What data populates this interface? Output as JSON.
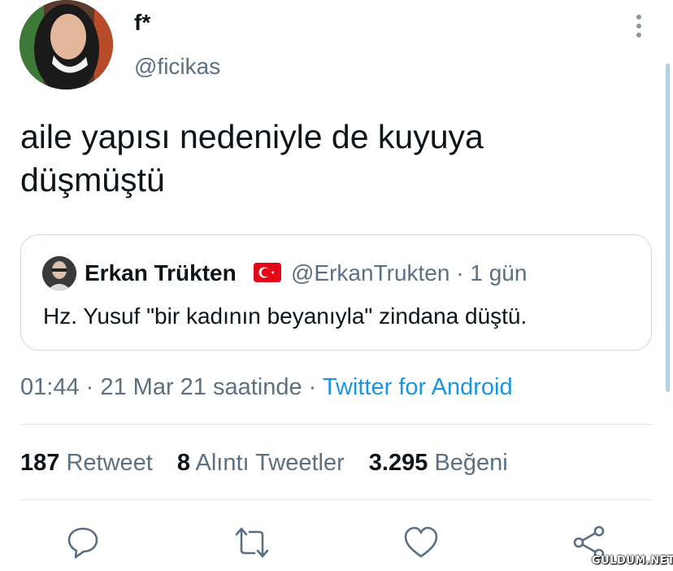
{
  "author": {
    "display_name": "f*",
    "handle": "@ficikas"
  },
  "tweet": {
    "text_line1": "aile yapısı nedeniyle de kuyuya",
    "text_line2": "düşmüştü"
  },
  "quoted_tweet": {
    "display_name": "Erkan Trükten",
    "handle_time": "@ErkanTrukten · 1 gün",
    "text": "Hz. Yusuf \"bir kadının beyanıyla\" zindana düştü."
  },
  "meta": {
    "timestamp": "01:44 · 21 Mar 21 saatinde · ",
    "source": "Twitter for Android"
  },
  "stats": {
    "retweets": "187",
    "retweets_label": "Retweet",
    "quotes": "8",
    "quotes_label": "Alıntı Tweetler",
    "likes": "3.295",
    "likes_label": "Beğeni"
  },
  "watermark": "GULDUM.NET",
  "icons": [
    "more-icon",
    "reply-icon",
    "retweet-icon",
    "like-icon",
    "share-icon"
  ],
  "colors": {
    "text": "#0f1419",
    "secondary": "#5b7083",
    "link": "#1b95e0",
    "border": "#cfd9de"
  }
}
